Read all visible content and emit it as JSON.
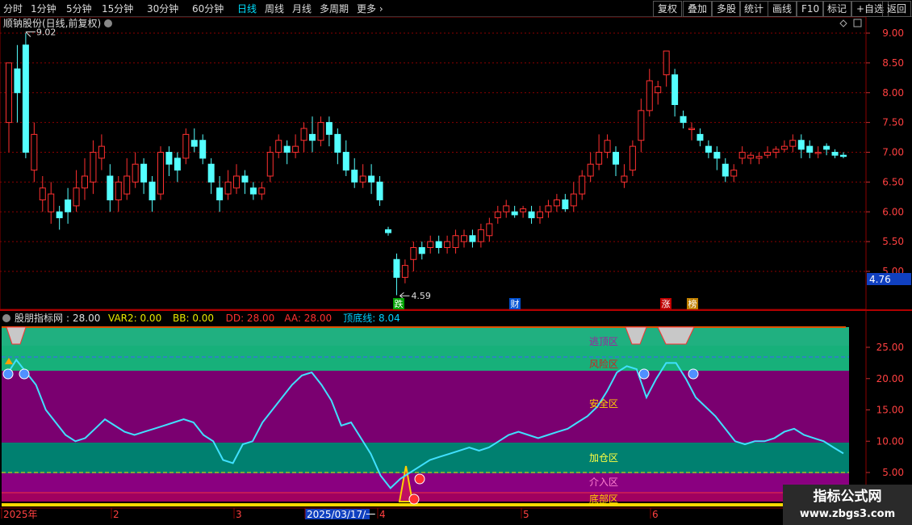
{
  "toolbar": {
    "left": [
      "分时",
      "1分钟",
      "5分钟",
      "15分钟",
      "30分钟",
      "60分钟",
      "日线",
      "周线",
      "月线",
      "多周期",
      "更多"
    ],
    "active": "日线",
    "right": [
      "复权",
      "叠加",
      "多股",
      "统计",
      "画线",
      "F10",
      "标记",
      "+自选",
      "返回"
    ]
  },
  "main_title": "顺钠股份(日线,前复权)",
  "indicator_title": {
    "name": "股朋指标网",
    "items": [
      {
        "label": "28.00",
        "color": "#e0e0e0"
      },
      {
        "label": "VAR2: 0.00",
        "color": "#e8e800"
      },
      {
        "label": "BB: 0.00",
        "color": "#e8e800"
      },
      {
        "label": "DD: 28.00",
        "color": "#ff3030"
      },
      {
        "label": "AA: 28.00",
        "color": "#ff3030"
      },
      {
        "label": "顶底线: 8.04",
        "color": "#00d0ff"
      }
    ]
  },
  "price_marker": "4.76",
  "high_label": "9.02",
  "low_label": "4.59",
  "event_tags": [
    "跌",
    "财",
    "涨",
    "榜"
  ],
  "zone_labels": [
    "逃顶区",
    "风险区",
    "安全区",
    "加仓区",
    "介入区",
    "底部区"
  ],
  "x_axis_labels": [
    "2025年",
    "2",
    "3",
    "2025/03/17/一",
    "4",
    "5",
    "6"
  ],
  "watermark": {
    "title": "指标公式网",
    "url": "www.zbgs3.com"
  },
  "colors": {
    "up": "#ff3030",
    "down": "#54ffff",
    "grid": "#8b0000",
    "line": "#40e0ff"
  },
  "chart_data": [
    {
      "type": "candlestick",
      "title": "顺钠股份(日线,前复权)",
      "ylim": [
        4.5,
        9.3
      ],
      "y_ticks": [
        9.0,
        8.5,
        8.0,
        7.5,
        7.0,
        6.5,
        6.0,
        5.5,
        5.0
      ],
      "annotations": [
        {
          "text": "9.02",
          "value": 9.02
        },
        {
          "text": "4.59",
          "value": 4.59
        }
      ],
      "candles": [
        [
          7.5,
          8.5,
          8.5,
          7.0
        ],
        [
          8.4,
          8.0,
          8.8,
          7.5
        ],
        [
          8.8,
          7.0,
          9.0,
          6.9
        ],
        [
          6.7,
          7.3,
          7.5,
          6.5
        ],
        [
          6.2,
          6.4,
          6.6,
          6.0
        ],
        [
          6.0,
          6.3,
          6.5,
          5.8
        ],
        [
          6.0,
          5.9,
          6.1,
          5.7
        ],
        [
          6.2,
          6.0,
          6.4,
          5.8
        ],
        [
          6.1,
          6.4,
          6.7,
          6.0
        ],
        [
          6.4,
          6.6,
          6.9,
          6.2
        ],
        [
          6.5,
          7.0,
          7.2,
          6.3
        ],
        [
          6.9,
          7.1,
          7.3,
          6.7
        ],
        [
          6.6,
          6.2,
          6.8,
          6.0
        ],
        [
          6.2,
          6.5,
          6.6,
          6.0
        ],
        [
          6.3,
          6.6,
          6.9,
          6.2
        ],
        [
          6.5,
          6.8,
          7.0,
          6.4
        ],
        [
          6.8,
          6.5,
          6.9,
          6.3
        ],
        [
          6.5,
          6.2,
          6.6,
          6.0
        ],
        [
          6.3,
          7.0,
          7.1,
          6.2
        ],
        [
          7.0,
          6.8,
          7.1,
          6.6
        ],
        [
          6.9,
          6.7,
          7.0,
          6.5
        ],
        [
          6.9,
          7.3,
          7.4,
          6.8
        ],
        [
          7.2,
          7.1,
          7.4,
          7.0
        ],
        [
          7.2,
          6.9,
          7.3,
          6.8
        ],
        [
          6.8,
          6.5,
          6.9,
          6.3
        ],
        [
          6.4,
          6.2,
          6.6,
          6.0
        ],
        [
          6.3,
          6.5,
          6.7,
          6.2
        ],
        [
          6.4,
          6.6,
          6.8,
          6.3
        ],
        [
          6.6,
          6.5,
          6.7,
          6.3
        ],
        [
          6.4,
          6.3,
          6.5,
          6.2
        ],
        [
          6.3,
          6.4,
          6.5,
          6.2
        ],
        [
          6.6,
          7.0,
          7.1,
          6.5
        ],
        [
          7.0,
          7.2,
          7.3,
          6.9
        ],
        [
          7.1,
          7.0,
          7.2,
          6.8
        ],
        [
          7.0,
          7.1,
          7.3,
          6.9
        ],
        [
          7.2,
          7.4,
          7.5,
          7.0
        ],
        [
          7.3,
          7.2,
          7.6,
          7.0
        ],
        [
          7.2,
          7.5,
          7.6,
          7.1
        ],
        [
          7.5,
          7.3,
          7.6,
          7.1
        ],
        [
          7.3,
          7.0,
          7.4,
          6.8
        ],
        [
          7.0,
          6.7,
          7.2,
          6.6
        ],
        [
          6.7,
          6.5,
          6.9,
          6.4
        ],
        [
          6.5,
          6.6,
          6.8,
          6.4
        ],
        [
          6.6,
          6.5,
          6.8,
          6.3
        ],
        [
          6.5,
          6.2,
          6.6,
          6.1
        ],
        [
          5.7,
          5.65,
          5.75,
          5.6
        ],
        [
          5.2,
          4.9,
          5.3,
          4.6
        ],
        [
          4.9,
          5.1,
          5.2,
          4.8
        ],
        [
          5.2,
          5.4,
          5.5,
          5.0
        ],
        [
          5.4,
          5.3,
          5.5,
          5.2
        ],
        [
          5.4,
          5.5,
          5.6,
          5.3
        ],
        [
          5.5,
          5.4,
          5.6,
          5.3
        ],
        [
          5.4,
          5.5,
          5.6,
          5.3
        ],
        [
          5.4,
          5.6,
          5.7,
          5.3
        ],
        [
          5.5,
          5.6,
          5.7,
          5.4
        ],
        [
          5.6,
          5.5,
          5.7,
          5.4
        ],
        [
          5.5,
          5.7,
          5.8,
          5.4
        ],
        [
          5.6,
          5.8,
          5.9,
          5.5
        ],
        [
          5.9,
          6.0,
          6.1,
          5.8
        ],
        [
          6.0,
          6.1,
          6.2,
          5.9
        ],
        [
          6.0,
          5.95,
          6.1,
          5.9
        ],
        [
          6.0,
          6.05,
          6.1,
          5.9
        ],
        [
          6.0,
          5.9,
          6.1,
          5.8
        ],
        [
          5.9,
          6.0,
          6.1,
          5.8
        ],
        [
          6.0,
          6.1,
          6.2,
          5.9
        ],
        [
          6.1,
          6.2,
          6.3,
          6.0
        ],
        [
          6.2,
          6.05,
          6.3,
          6.0
        ],
        [
          6.1,
          6.3,
          6.5,
          6.0
        ],
        [
          6.3,
          6.6,
          6.7,
          6.2
        ],
        [
          6.6,
          6.8,
          7.0,
          6.5
        ],
        [
          6.8,
          7.0,
          7.3,
          6.7
        ],
        [
          7.0,
          7.2,
          7.3,
          6.9
        ],
        [
          7.0,
          6.8,
          7.1,
          6.6
        ],
        [
          6.5,
          6.6,
          6.8,
          6.4
        ],
        [
          6.7,
          7.1,
          7.2,
          6.6
        ],
        [
          7.2,
          7.7,
          7.9,
          7.0
        ],
        [
          7.7,
          8.2,
          8.4,
          7.6
        ],
        [
          8.0,
          8.1,
          8.2,
          7.8
        ],
        [
          8.3,
          8.7,
          8.7,
          8.1
        ],
        [
          8.3,
          7.8,
          8.4,
          7.6
        ],
        [
          7.6,
          7.5,
          7.7,
          7.4
        ],
        [
          7.4,
          7.4,
          7.5,
          7.2
        ],
        [
          7.3,
          7.2,
          7.4,
          7.1
        ],
        [
          7.1,
          7.0,
          7.2,
          6.9
        ],
        [
          7.0,
          6.9,
          7.1,
          6.7
        ],
        [
          6.8,
          6.6,
          6.9,
          6.5
        ],
        [
          6.6,
          6.7,
          6.8,
          6.5
        ],
        [
          6.9,
          7.0,
          7.1,
          6.8
        ],
        [
          6.9,
          6.95,
          7.0,
          6.8
        ],
        [
          6.9,
          6.93,
          7.0,
          6.8
        ],
        [
          6.95,
          7.0,
          7.1,
          6.9
        ],
        [
          7.0,
          7.05,
          7.1,
          6.9
        ],
        [
          7.05,
          7.1,
          7.2,
          7.0
        ],
        [
          7.1,
          7.2,
          7.3,
          7.0
        ],
        [
          7.2,
          7.05,
          7.3,
          6.9
        ],
        [
          7.1,
          7.0,
          7.2,
          6.9
        ],
        [
          7.0,
          7.0,
          7.1,
          6.9
        ],
        [
          7.1,
          7.05,
          7.15,
          6.95
        ],
        [
          7.0,
          6.95,
          7.05,
          6.9
        ],
        [
          6.95,
          6.93,
          7.0,
          6.9
        ]
      ]
    },
    {
      "type": "line",
      "ylim": [
        0,
        29
      ],
      "y_ticks": [
        25.0,
        20.0,
        15.0,
        10.0,
        5.0
      ],
      "series": [
        {
          "name": "顶底线",
          "values": [
            20.5,
            23.0,
            21.0,
            19.0,
            15.0,
            13.0,
            11.0,
            10.0,
            10.5,
            12.0,
            13.5,
            12.5,
            11.5,
            11.0,
            11.5,
            12.0,
            12.5,
            13.0,
            13.5,
            13.0,
            11.0,
            10.0,
            7.0,
            6.5,
            9.5,
            10.0,
            13.0,
            15.0,
            17.0,
            19.0,
            20.5,
            21.0,
            19.0,
            16.5,
            12.5,
            13.0,
            10.5,
            8.0,
            4.5,
            2.5,
            4.0,
            5.0,
            6.0,
            7.0,
            7.5,
            8.0,
            8.5,
            9.0,
            8.5,
            9.0,
            10.0,
            11.0,
            11.5,
            11.0,
            10.5,
            11.0,
            11.5,
            12.0,
            13.0,
            14.0,
            15.5,
            18.0,
            21.0,
            22.0,
            21.5,
            17.0,
            20.0,
            22.5,
            22.5,
            20.0,
            17.0,
            15.5,
            14.0,
            12.0,
            10.0,
            9.5,
            10.0,
            10.0,
            10.5,
            11.5,
            12.0,
            11.0,
            10.5,
            10.0,
            9.0,
            8.04
          ]
        }
      ]
    }
  ]
}
